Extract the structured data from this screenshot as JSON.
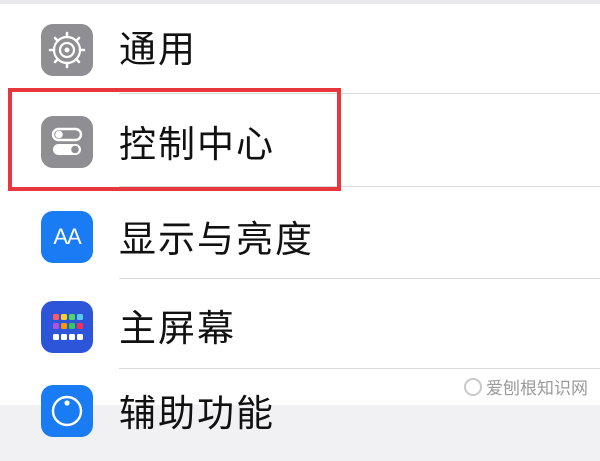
{
  "settings": {
    "items": [
      {
        "label": "通用",
        "icon": "gear-icon",
        "icon_bg": "#8e8e93"
      },
      {
        "label": "控制中心",
        "icon": "toggles-icon",
        "icon_bg": "#8e8e93"
      },
      {
        "label": "显示与亮度",
        "icon": "text-size-icon",
        "icon_bg": "#1a7cf5",
        "icon_text": "AA"
      },
      {
        "label": "主屏幕",
        "icon": "home-screen-icon",
        "icon_bg": "#2c55d9"
      },
      {
        "label": "辅助功能",
        "icon": "accessibility-icon",
        "icon_bg": "#1a7cf5"
      }
    ]
  },
  "highlight_color": "#e8363f",
  "watermark": "爱刨根知识网"
}
